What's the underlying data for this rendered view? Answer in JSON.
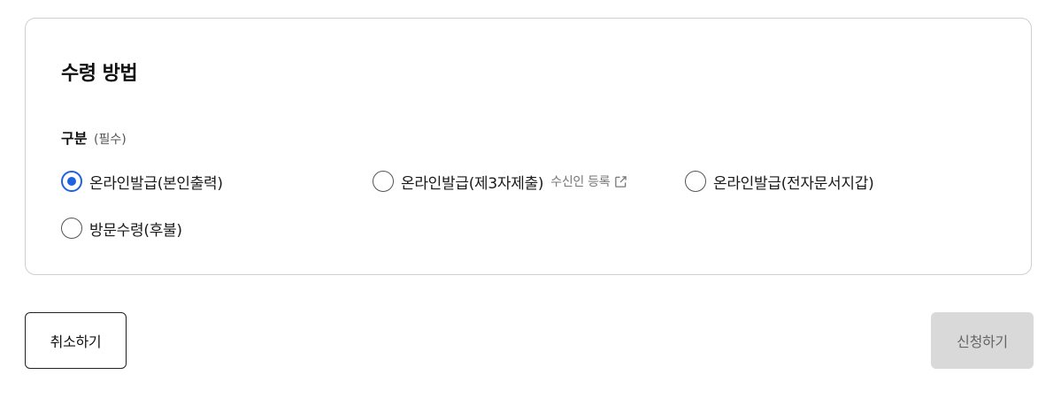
{
  "section": {
    "title": "수령 방법"
  },
  "field": {
    "label": "구분",
    "required_text": "(필수)"
  },
  "options": [
    {
      "label": "온라인발급(본인출력)",
      "selected": true
    },
    {
      "label": "온라인발급(제3자제출)",
      "selected": false,
      "link_text": "수신인 등록",
      "link_icon": "external-link-icon"
    },
    {
      "label": "온라인발급(전자문서지갑)",
      "selected": false
    },
    {
      "label": "방문수령(후불)",
      "selected": false
    }
  ],
  "buttons": {
    "cancel_label": "취소하기",
    "submit_label": "신청하기"
  },
  "colors": {
    "accent": "#1f62e0",
    "card_border": "#cfcfcf",
    "submit_disabled_bg": "#d9d9d9",
    "submit_disabled_text": "#666666"
  }
}
